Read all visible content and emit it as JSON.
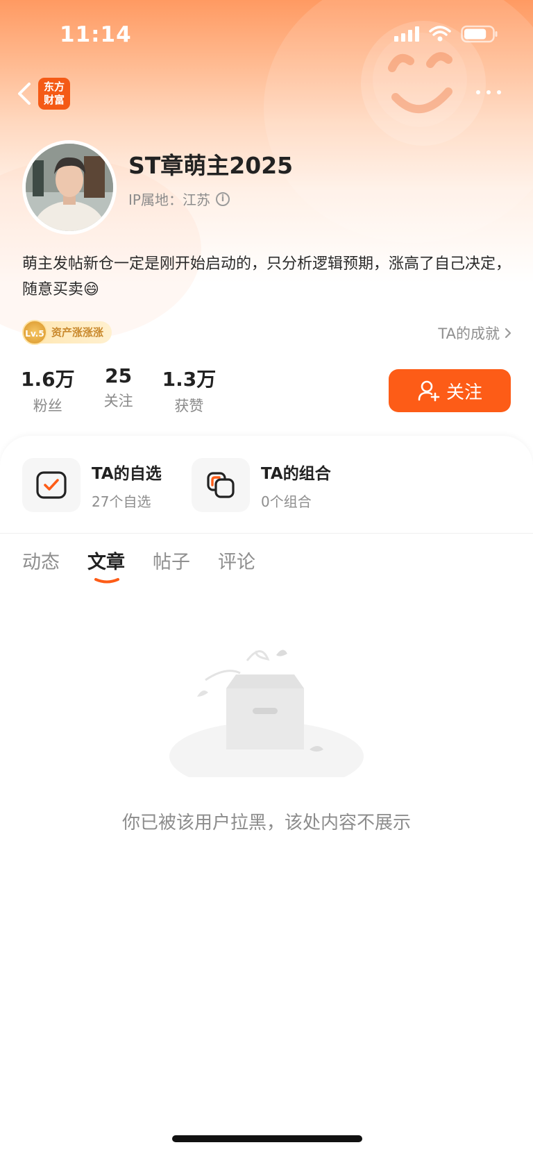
{
  "status_bar": {
    "time": "11:14",
    "battery_level": 0.8
  },
  "nav": {
    "back_icon": "chevron-left-icon",
    "app_logo_text_line1": "东方",
    "app_logo_text_line2": "财富",
    "more_icon": "more-dots-icon"
  },
  "profile": {
    "username": "ST章萌主2025",
    "ip_label": "IP属地",
    "ip_sep": "：",
    "ip_location": "江苏",
    "bio": "萌主发帖新仓一定是刚开始启动的，只分析逻辑预期，涨高了自己决定，随意买卖😄",
    "level_label": "Lv.5",
    "level_title": "资产涨涨涨",
    "achievements_label": "TA的成就"
  },
  "stats": [
    {
      "value": "1.6万",
      "label": "粉丝"
    },
    {
      "value": "25",
      "label": "关注"
    },
    {
      "value": "1.3万",
      "label": "获赞"
    }
  ],
  "follow_button": {
    "label": "关注",
    "icon": "add-user-icon",
    "color": "#fd5c17"
  },
  "quick_links": [
    {
      "title": "TA的自选",
      "subtitle": "27个自选",
      "icon": "checkbox-icon"
    },
    {
      "title": "TA的组合",
      "subtitle": "0个组合",
      "icon": "stack-icon"
    }
  ],
  "tabs": [
    {
      "label": "动态",
      "active": false
    },
    {
      "label": "文章",
      "active": true
    },
    {
      "label": "帖子",
      "active": false
    },
    {
      "label": "评论",
      "active": false
    }
  ],
  "empty_state": {
    "message": "你已被该用户拉黑，该处内容不展示",
    "icon": "empty-box-icon"
  },
  "colors": {
    "accent": "#fd5c17",
    "text_primary": "#222222",
    "text_secondary": "#8c8c8c"
  }
}
